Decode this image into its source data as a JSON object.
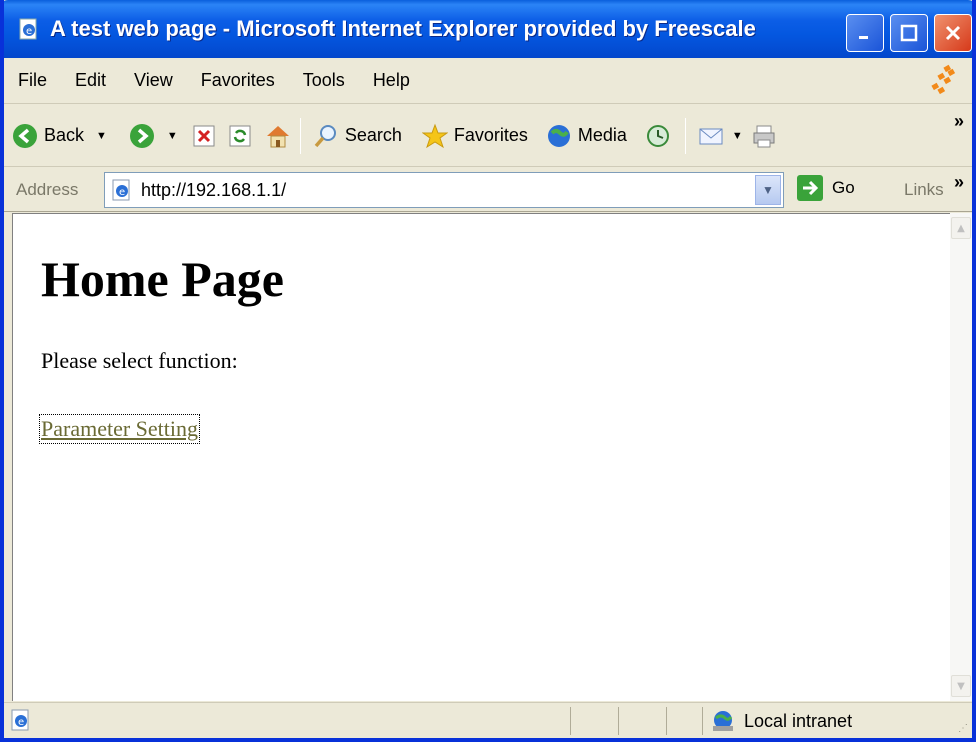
{
  "window": {
    "title": "A test web page - Microsoft Internet Explorer provided by Freescale"
  },
  "menu": {
    "items": [
      "File",
      "Edit",
      "View",
      "Favorites",
      "Tools",
      "Help"
    ]
  },
  "toolbar": {
    "back_label": "Back",
    "search_label": "Search",
    "favorites_label": "Favorites",
    "media_label": "Media"
  },
  "address": {
    "label": "Address",
    "url": "http://192.168.1.1/",
    "go_label": "Go",
    "links_label": "Links"
  },
  "page": {
    "heading": "Home Page",
    "prompt": "Please select function:",
    "link": "Parameter Setting"
  },
  "status": {
    "zone": "Local intranet"
  },
  "colors": {
    "titlebar": "#0457e0",
    "link": "#6a6a34",
    "chrome": "#ece9d8"
  }
}
